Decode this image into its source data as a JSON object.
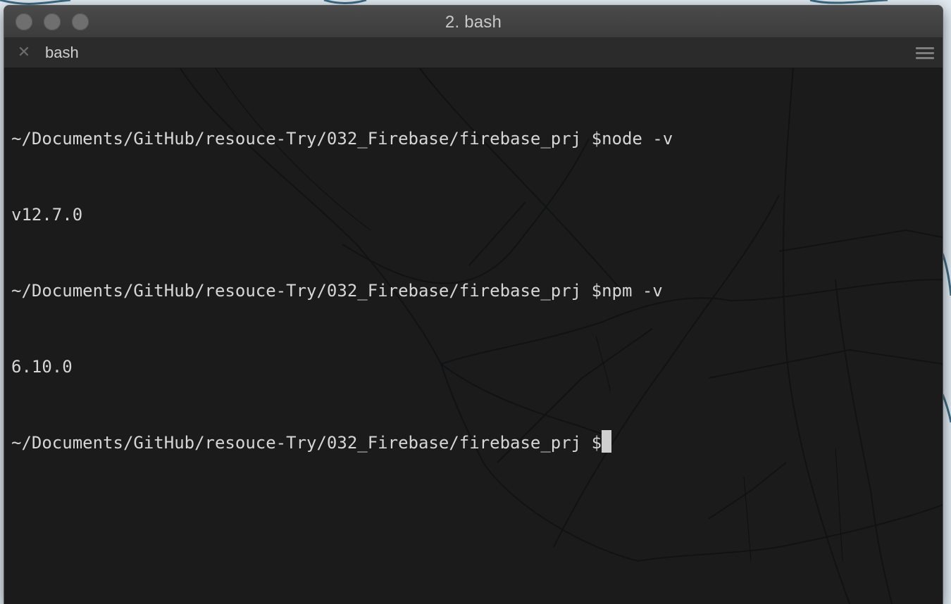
{
  "window": {
    "title": "2. bash",
    "tab_label": "bash"
  },
  "icons": {
    "tab_close": "close-icon",
    "menu": "hamburger-menu-icon"
  },
  "terminal": {
    "lines": [
      {
        "prompt": "~/Documents/GitHub/resouce-Try/032_Firebase/firebase_prj $",
        "command": "node -v"
      },
      {
        "output": "v12.7.0"
      },
      {
        "prompt": "~/Documents/GitHub/resouce-Try/032_Firebase/firebase_prj $",
        "command": "npm -v"
      },
      {
        "output": "6.10.0"
      },
      {
        "prompt": "~/Documents/GitHub/resouce-Try/032_Firebase/firebase_prj $",
        "command": ""
      }
    ]
  },
  "colors": {
    "terminal_bg": "#1b1b1b",
    "text": "#d6d6d6",
    "titlebar": "#404040",
    "tabbar": "#2b2b2b"
  }
}
